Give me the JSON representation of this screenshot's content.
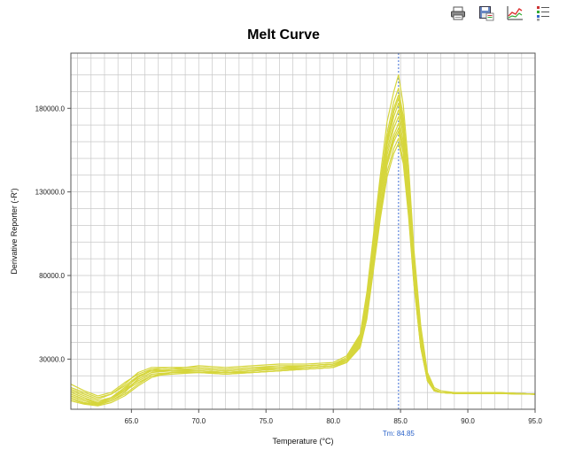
{
  "toolbar": {
    "buttons": [
      {
        "name": "print-button",
        "icon": "printer-icon"
      },
      {
        "name": "save-button",
        "icon": "save-icon"
      },
      {
        "name": "plot-button",
        "icon": "chart-line-icon"
      },
      {
        "name": "legend-button",
        "icon": "legend-list-icon"
      }
    ]
  },
  "chart_data": {
    "type": "line",
    "title": "Melt Curve",
    "xlabel": "Temperature (°C)",
    "ylabel": "Derivative Reporter (-R')",
    "xlim": [
      60.5,
      95.0
    ],
    "ylim": [
      0,
      213000
    ],
    "x_ticks": [
      65.0,
      70.0,
      75.0,
      80.0,
      85.0,
      90.0,
      95.0
    ],
    "x_tick_labels": [
      "65.0",
      "70.0",
      "75.0",
      "80.0",
      "85.0",
      "90.0",
      "95.0"
    ],
    "y_ticks": [
      30000,
      80000,
      130000,
      180000
    ],
    "y_tick_labels": [
      "30000.0",
      "80000.0",
      "130000.0",
      "180000.0"
    ],
    "grid": true,
    "line_color": "#d6d63c",
    "threshold": {
      "x": 84.85,
      "label": "Tm: 84.85",
      "color": "#3f6fd6"
    },
    "x": [
      60.5,
      61.5,
      62.5,
      63.5,
      64.5,
      65.5,
      66.5,
      68,
      70,
      72,
      74,
      76,
      78,
      80,
      81,
      82,
      82.5,
      83,
      83.5,
      84,
      84.5,
      84.85,
      85.2,
      85.6,
      86,
      86.5,
      87,
      87.5,
      88,
      89,
      90,
      92,
      95
    ],
    "series": [
      {
        "values": [
          8000,
          5000,
          3000,
          5000,
          10000,
          18000,
          22000,
          24000,
          26000,
          25000,
          26000,
          27000,
          27000,
          28000,
          32000,
          45000,
          70000,
          105000,
          140000,
          172000,
          190000,
          200000,
          182000,
          145000,
          95000,
          50000,
          22000,
          13000,
          11000,
          10000,
          10000,
          10000,
          9000
        ]
      },
      {
        "values": [
          12000,
          9000,
          6000,
          9000,
          15000,
          22000,
          25000,
          25000,
          25000,
          24000,
          25000,
          26000,
          26000,
          27000,
          30000,
          42000,
          64000,
          98000,
          132000,
          160000,
          178000,
          186000,
          170000,
          133000,
          85000,
          44000,
          20000,
          12000,
          10000,
          10000,
          10000,
          10000,
          9000
        ]
      },
      {
        "values": [
          5000,
          3000,
          2000,
          4000,
          8000,
          14000,
          19000,
          22000,
          23000,
          22000,
          23000,
          24000,
          25000,
          26000,
          29000,
          40000,
          60000,
          92000,
          126000,
          152000,
          168000,
          175000,
          160000,
          125000,
          80000,
          40000,
          18000,
          11000,
          10000,
          9500,
          9500,
          9500,
          9000
        ]
      },
      {
        "values": [
          15000,
          11000,
          8000,
          10000,
          16000,
          21000,
          24000,
          23000,
          23000,
          22000,
          23000,
          24000,
          25000,
          26000,
          29000,
          38000,
          56000,
          88000,
          120000,
          146000,
          160000,
          166000,
          153000,
          120000,
          77000,
          38000,
          17000,
          11000,
          10000,
          9500,
          9500,
          9500,
          9000
        ]
      },
      {
        "values": [
          7000,
          4000,
          3000,
          6000,
          12000,
          20000,
          23000,
          24000,
          24000,
          23000,
          24000,
          24000,
          25000,
          26000,
          30000,
          41000,
          62000,
          94000,
          128000,
          155000,
          171000,
          179000,
          164000,
          128000,
          82000,
          41000,
          19000,
          12000,
          10000,
          10000,
          10000,
          10000,
          9000
        ]
      },
      {
        "values": [
          10000,
          7000,
          4000,
          6000,
          11000,
          16000,
          20000,
          21000,
          22000,
          21000,
          22000,
          23000,
          24000,
          25000,
          28000,
          37000,
          54000,
          84000,
          114000,
          139000,
          153000,
          159000,
          147000,
          115000,
          74000,
          37000,
          17000,
          11000,
          10000,
          9500,
          9500,
          9500,
          9000
        ]
      },
      {
        "values": [
          9000,
          6000,
          4000,
          7000,
          13000,
          19000,
          24000,
          25000,
          25000,
          24000,
          25000,
          25000,
          26000,
          27000,
          31000,
          44000,
          67000,
          101000,
          136000,
          165000,
          184000,
          192000,
          175000,
          138000,
          89000,
          46000,
          21000,
          12000,
          10000,
          10000,
          10000,
          10000,
          9000
        ]
      },
      {
        "values": [
          6000,
          3500,
          2500,
          5000,
          9000,
          15000,
          20000,
          22000,
          22000,
          22000,
          22000,
          23000,
          24000,
          25000,
          28000,
          39000,
          58000,
          90000,
          122000,
          149000,
          164000,
          171000,
          157000,
          123000,
          78000,
          39000,
          18000,
          11000,
          10000,
          9500,
          9500,
          9500,
          9000
        ]
      },
      {
        "values": [
          13000,
          10000,
          7000,
          9000,
          14000,
          20000,
          23000,
          23000,
          23000,
          22000,
          23000,
          24000,
          24000,
          25000,
          28000,
          38000,
          57000,
          86000,
          117000,
          142000,
          156000,
          162000,
          149000,
          117000,
          75000,
          37000,
          17000,
          11000,
          10000,
          9500,
          9500,
          9500,
          9000
        ]
      },
      {
        "values": [
          8000,
          5000,
          3500,
          6000,
          11000,
          18000,
          22000,
          23000,
          24000,
          23000,
          24000,
          25000,
          26000,
          27000,
          30000,
          42000,
          63000,
          96000,
          130000,
          158000,
          175000,
          183000,
          167000,
          131000,
          84000,
          42000,
          19000,
          12000,
          10000,
          10000,
          10000,
          10000,
          9000
        ]
      },
      {
        "values": [
          11000,
          8000,
          5000,
          7000,
          12000,
          17000,
          21000,
          22000,
          22000,
          21000,
          22000,
          23000,
          24000,
          25000,
          29000,
          40000,
          59000,
          89000,
          121000,
          147000,
          162000,
          168000,
          154000,
          121000,
          77000,
          38000,
          17000,
          11000,
          10000,
          9500,
          9500,
          9500,
          9000
        ]
      },
      {
        "values": [
          9000,
          6000,
          4000,
          7000,
          13000,
          19000,
          23000,
          24000,
          24000,
          23000,
          24000,
          25000,
          25000,
          26000,
          30000,
          43000,
          65000,
          99000,
          134000,
          162000,
          180000,
          188000,
          172000,
          135000,
          87000,
          45000,
          20000,
          12000,
          10000,
          10000,
          10000,
          10000,
          9000
        ]
      }
    ]
  }
}
